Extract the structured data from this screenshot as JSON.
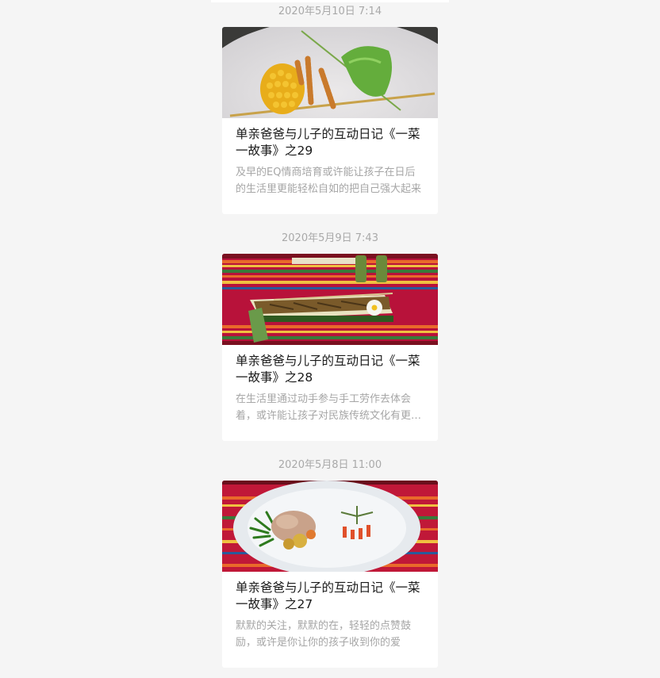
{
  "articles": [
    {
      "time": "2020年5月10日 7:14",
      "title": "单亲爸爸与儿子的互动日记《一菜一故事》之29",
      "digest": "及早的EQ情商培育或许能让孩子在日后的生活里更能轻松自如的把自己强大起来",
      "thumbnail": "corn-pasta-cucumber-fish-plate-photo"
    },
    {
      "time": "2020年5月9日 7:43",
      "title": "单亲爸爸与儿子的互动日记《一菜一故事》之28",
      "digest": "在生活里通过动手参与手工劳作去体会着，或许能让孩子对民族传统文化有更深的认识",
      "thumbnail": "bamboo-boat-dried-fish-striped-cloth-photo"
    },
    {
      "time": "2020年5月8日 11:00",
      "title": "单亲爸爸与儿子的互动日记《一菜一故事》之27",
      "digest": "默默的关注，默默的在，轻轻的点赞鼓励，或许是你让你的孩子收到你的爱",
      "thumbnail": "meat-dish-white-plate-striped-cloth-photo"
    }
  ]
}
